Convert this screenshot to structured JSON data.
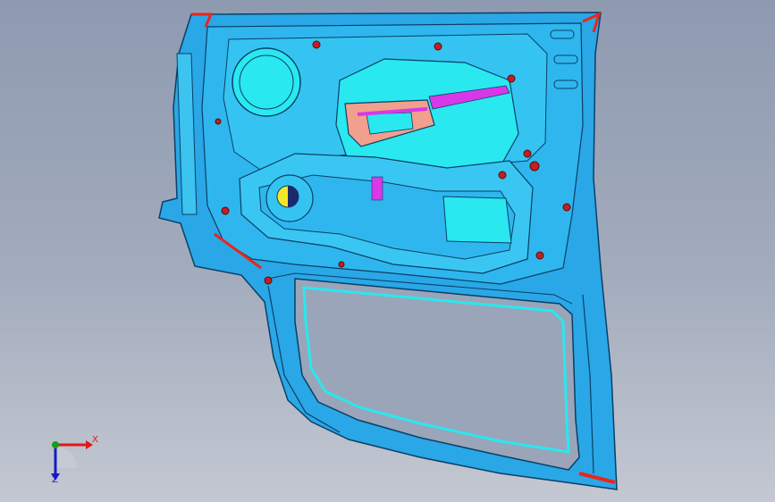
{
  "colors": {
    "panel": "#29a6e6",
    "panel_light": "#3cc3f0",
    "panel_cyan": "#29e8f0",
    "edge": "#0a3f66",
    "red": "#e8261c",
    "magenta": "#d838e8",
    "salmon": "#f0a08c",
    "yellow": "#f5e62a",
    "x_axis": "#e01818",
    "y_axis": "#18a018",
    "z_axis": "#1818c8"
  },
  "triad": {
    "x_label": "X",
    "z_label": "Z"
  }
}
